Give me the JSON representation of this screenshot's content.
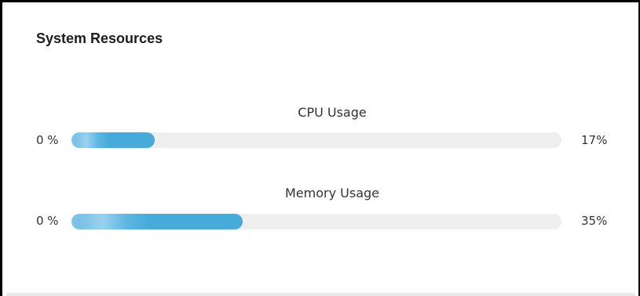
{
  "panel": {
    "title": "System Resources"
  },
  "meters": [
    {
      "label": "CPU Usage",
      "min_label": "0 %",
      "value_label": "17%",
      "fraction": 0.17,
      "color": "#47aad9"
    },
    {
      "label": "Memory Usage",
      "min_label": "0 %",
      "value_label": "35%",
      "fraction": 0.35,
      "color": "#47aad9"
    }
  ],
  "colors": {
    "track": "#eeeeee",
    "fill": "#47aad9",
    "fill_light": "#7cc2e6"
  }
}
